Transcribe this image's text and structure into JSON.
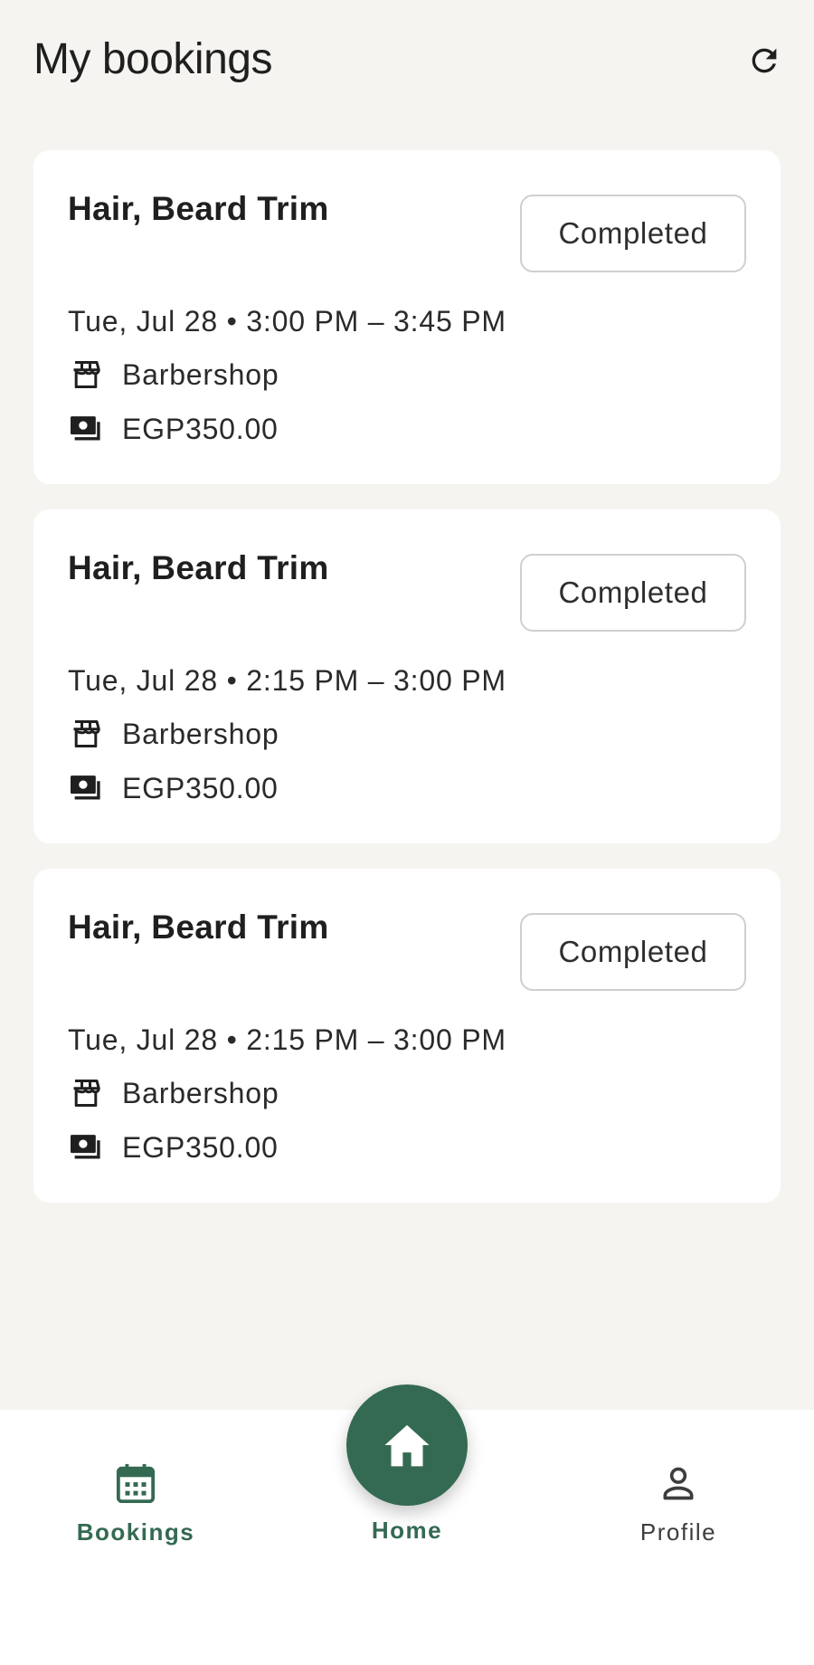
{
  "header": {
    "title": "My bookings",
    "refresh_icon": "refresh-icon"
  },
  "bookings": [
    {
      "title": "Hair, Beard Trim",
      "status": "Completed",
      "datetime": "Tue, Jul 28 • 3:00 PM – 3:45 PM",
      "shop": "Barbershop",
      "price": "EGP350.00"
    },
    {
      "title": "Hair, Beard Trim",
      "status": "Completed",
      "datetime": "Tue, Jul 28 • 2:15 PM – 3:00 PM",
      "shop": "Barbershop",
      "price": "EGP350.00"
    },
    {
      "title": "Hair, Beard Trim",
      "status": "Completed",
      "datetime": "Tue, Jul 28 • 2:15 PM – 3:00 PM",
      "shop": "Barbershop",
      "price": "EGP350.00"
    }
  ],
  "nav": {
    "bookings_label": "Bookings",
    "home_label": "Home",
    "profile_label": "Profile",
    "active": "Bookings"
  },
  "colors": {
    "accent": "#346a52",
    "background": "#f5f4f1",
    "card": "#ffffff",
    "badge_border": "#cfcfcf"
  }
}
